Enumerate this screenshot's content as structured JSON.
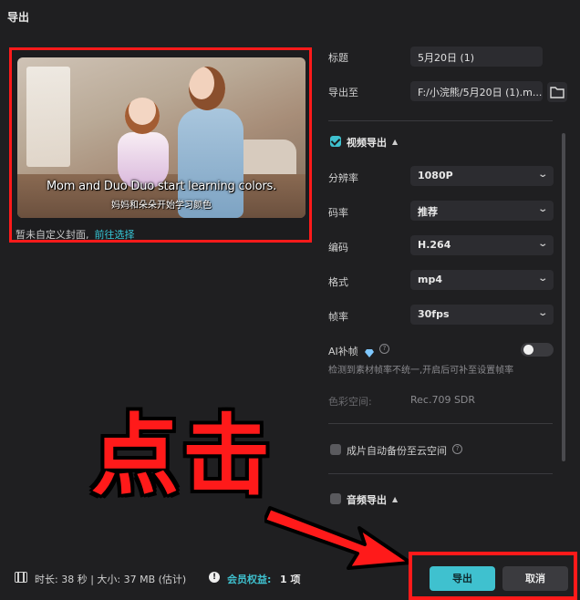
{
  "dialog": {
    "title": "导出"
  },
  "preview": {
    "subtitle_en": "Mom and Duo Duo start learning colors.",
    "subtitle_cn": "妈妈和朵朵开始学习颜色",
    "cover_text": "暂未自定义封面,",
    "cover_link": "前往选择"
  },
  "form": {
    "title_label": "标题",
    "title_value": "5月20日 (1)",
    "export_to_label": "导出至",
    "export_to_value": "F:/小浣熊/5月20日 (1).m...",
    "video_section": {
      "label": "视频导出",
      "checked": true
    },
    "resolution": {
      "label": "分辨率",
      "value": "1080P"
    },
    "bitrate": {
      "label": "码率",
      "value": "推荐"
    },
    "codec": {
      "label": "编码",
      "value": "H.264"
    },
    "format": {
      "label": "格式",
      "value": "mp4"
    },
    "framerate": {
      "label": "帧率",
      "value": "30fps"
    },
    "ai_frame": {
      "label": "AI补帧",
      "enabled": false,
      "hint": "检测到素材帧率不统一,开启后可补至设置帧率"
    },
    "color_space": {
      "label": "色彩空间:",
      "value": "Rec.709 SDR"
    },
    "cloud_backup": {
      "label": "成片自动备份至云空间",
      "checked": false
    },
    "audio_section": {
      "label": "音频导出",
      "checked": false
    }
  },
  "overlay": {
    "big_text": "点击"
  },
  "footer": {
    "info": "时长: 38 秒 | 大小: 37 MB (估计)",
    "member_label": "会员权益:",
    "member_value": "1 项",
    "export_button": "导出",
    "cancel_button": "取消"
  },
  "colors": {
    "accent": "#3fc1cf",
    "highlight_red": "#ff1a1a",
    "background": "#1f1f21"
  }
}
